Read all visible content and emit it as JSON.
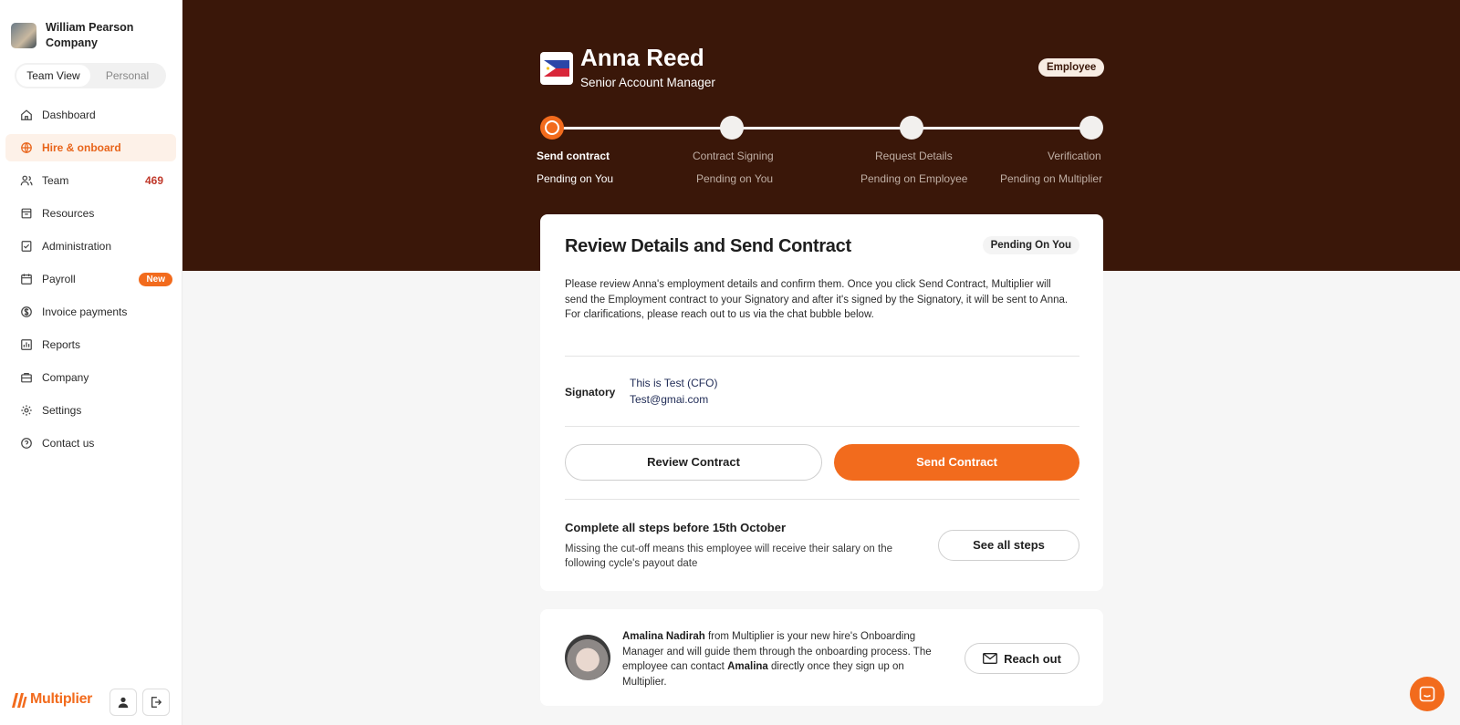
{
  "org": {
    "name": "William Pearson Company"
  },
  "view_toggle": {
    "team": "Team View",
    "personal": "Personal"
  },
  "nav": {
    "items": [
      {
        "label": "Dashboard",
        "icon": "home-icon"
      },
      {
        "label": "Hire & onboard",
        "icon": "globe-icon"
      },
      {
        "label": "Team",
        "icon": "users-icon",
        "count": "469"
      },
      {
        "label": "Resources",
        "icon": "box-icon"
      },
      {
        "label": "Administration",
        "icon": "checklist-icon"
      },
      {
        "label": "Payroll",
        "icon": "calendar-icon",
        "badge": "New"
      },
      {
        "label": "Invoice payments",
        "icon": "dollar-icon"
      },
      {
        "label": "Reports",
        "icon": "bar-chart-icon"
      },
      {
        "label": "Company",
        "icon": "briefcase-icon"
      },
      {
        "label": "Settings",
        "icon": "gear-icon"
      },
      {
        "label": "Contact us",
        "icon": "help-icon"
      }
    ],
    "active": "Hire & onboard"
  },
  "brand": {
    "name": "Multiplier"
  },
  "employee": {
    "name": "Anna Reed",
    "role": "Senior Account Manager",
    "badge": "Employee",
    "country_flag": "philippines-flag"
  },
  "steps": [
    {
      "label": "Send contract",
      "status": "Pending on You"
    },
    {
      "label": "Contract Signing",
      "status": "Pending on You"
    },
    {
      "label": "Request Details",
      "status": "Pending on Employee"
    },
    {
      "label": "Verification",
      "status": "Pending on Multiplier"
    }
  ],
  "card": {
    "title": "Review Details and Send Contract",
    "badge": "Pending On You",
    "description_1": "Please review Anna's employment details and confirm them. Once you click Send Contract, Multiplier will send the Employment contract to your Signatory and after it's signed by the Signatory, it will be sent to Anna.",
    "description_2": "For clarifications, please reach out to us via the chat bubble below.",
    "signatory_label": "Signatory",
    "signatory_name": "This is Test (CFO)",
    "signatory_email": "Test@gmai.com",
    "review_button": "Review Contract",
    "send_button": "Send Contract",
    "cutoff_title": "Complete all steps before 15th October",
    "cutoff_desc": "Missing the cut-off means this employee will receive their salary on the following cycle's payout date",
    "see_steps_button": "See all steps"
  },
  "manager": {
    "name": "Amalina Nadirah",
    "text_1": " from Multiplier is your new hire's Onboarding Manager and will guide them through the onboarding process. The employee can contact ",
    "first_name": "Amalina",
    "text_2": " directly once they sign up on Multiplier.",
    "reach_button": "Reach out"
  },
  "colors": {
    "accent": "#f26b1d",
    "hero": "#3a1709"
  }
}
